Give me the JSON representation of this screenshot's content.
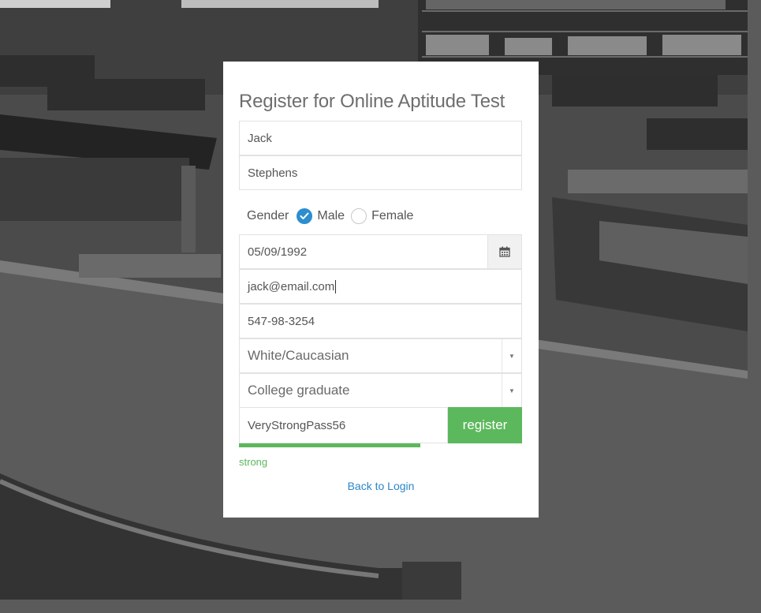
{
  "form": {
    "title": "Register for Online Aptitude Test",
    "first_name": "Jack",
    "last_name": "Stephens",
    "gender": {
      "label": "Gender",
      "options": [
        "Male",
        "Female"
      ],
      "selected": "Male"
    },
    "dob": "05/09/1992",
    "email": "jack@email.com",
    "phone": "547-98-3254",
    "race": "White/Caucasian",
    "education": "College graduate",
    "password": "VeryStrongPass56",
    "register_label": "register",
    "strength": {
      "label": "strong",
      "level": 0.8,
      "color": "#5cb85c"
    },
    "back_link": "Back to Login"
  },
  "icons": {
    "calendar": "calendar-icon",
    "check": "check-icon",
    "caret": "caret-down-icon"
  },
  "colors": {
    "accent_green": "#5cb85c",
    "radio_blue": "#2c8ecf",
    "link_blue": "#2a86c8"
  }
}
